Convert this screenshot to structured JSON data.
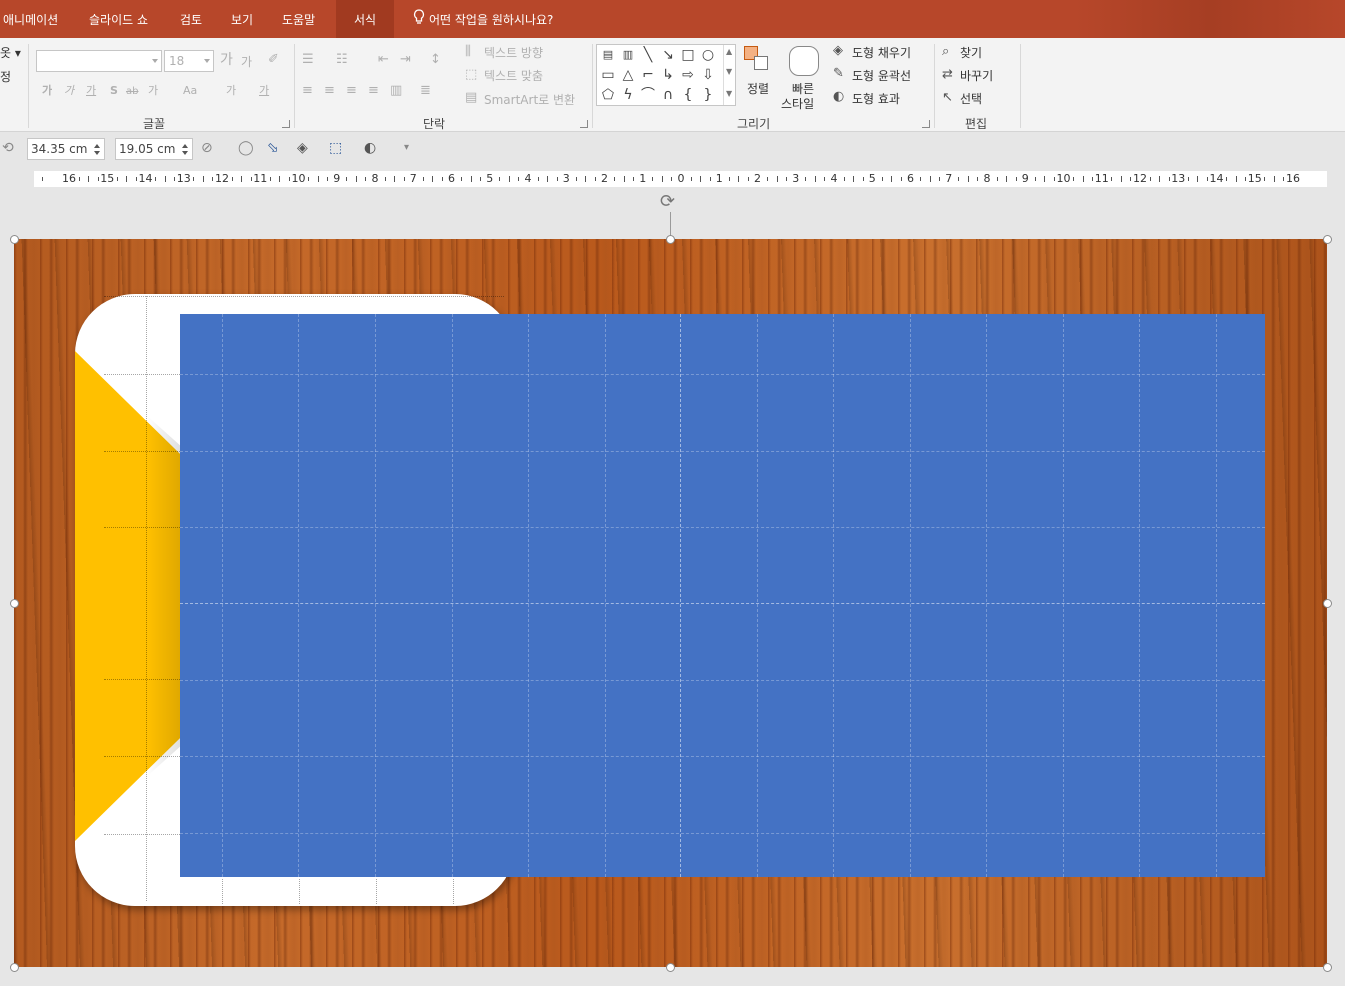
{
  "tabs": {
    "animation": "애니메이션",
    "slideshow": "슬라이드 쇼",
    "review": "검토",
    "view": "보기",
    "help": "도움말",
    "format": "서식",
    "tell_me": "어떤 작업을 원하시나요?"
  },
  "ribbon": {
    "left_cut_1": "옷 ▾",
    "left_cut_2": "정",
    "font": {
      "label": "글꼴",
      "font_name": "",
      "font_size": "18",
      "grow": "가",
      "shrink": "가",
      "bold": "가",
      "italic": "가",
      "underline": "가",
      "strike": "S",
      "abc": "ab",
      "spacing": "가",
      "case": "Aa",
      "highlight": "가",
      "color": "가"
    },
    "paragraph": {
      "label": "단락",
      "text_direction": "텍스트 방향",
      "align_text": "텍스트 맞춤",
      "smartart": "SmartArt로 변환"
    },
    "drawing": {
      "label": "그리기",
      "arrange": "정렬",
      "quick_styles_1": "빠른",
      "quick_styles_2": "스타일",
      "shape_fill": "도형 채우기",
      "shape_outline": "도형 윤곽선",
      "shape_effects": "도형 효과"
    },
    "editing": {
      "label": "편집",
      "find": "찾기",
      "replace": "바꾸기",
      "select": "선택"
    }
  },
  "format_bar": {
    "width": "34.35 cm",
    "height": "19.05 cm"
  },
  "ruler": {
    "labels": [
      "16",
      "15",
      "14",
      "13",
      "12",
      "11",
      "10",
      "9",
      "8",
      "7",
      "6",
      "5",
      "4",
      "3",
      "2",
      "1",
      "0",
      "1",
      "2",
      "3",
      "4",
      "5",
      "6",
      "7",
      "8",
      "9",
      "10",
      "11",
      "12",
      "13",
      "14",
      "15",
      "16"
    ]
  },
  "colors": {
    "accent": "#b7472a",
    "rectangle": "#4472c4",
    "triangle": "#ffc000",
    "card": "#ffffff"
  }
}
